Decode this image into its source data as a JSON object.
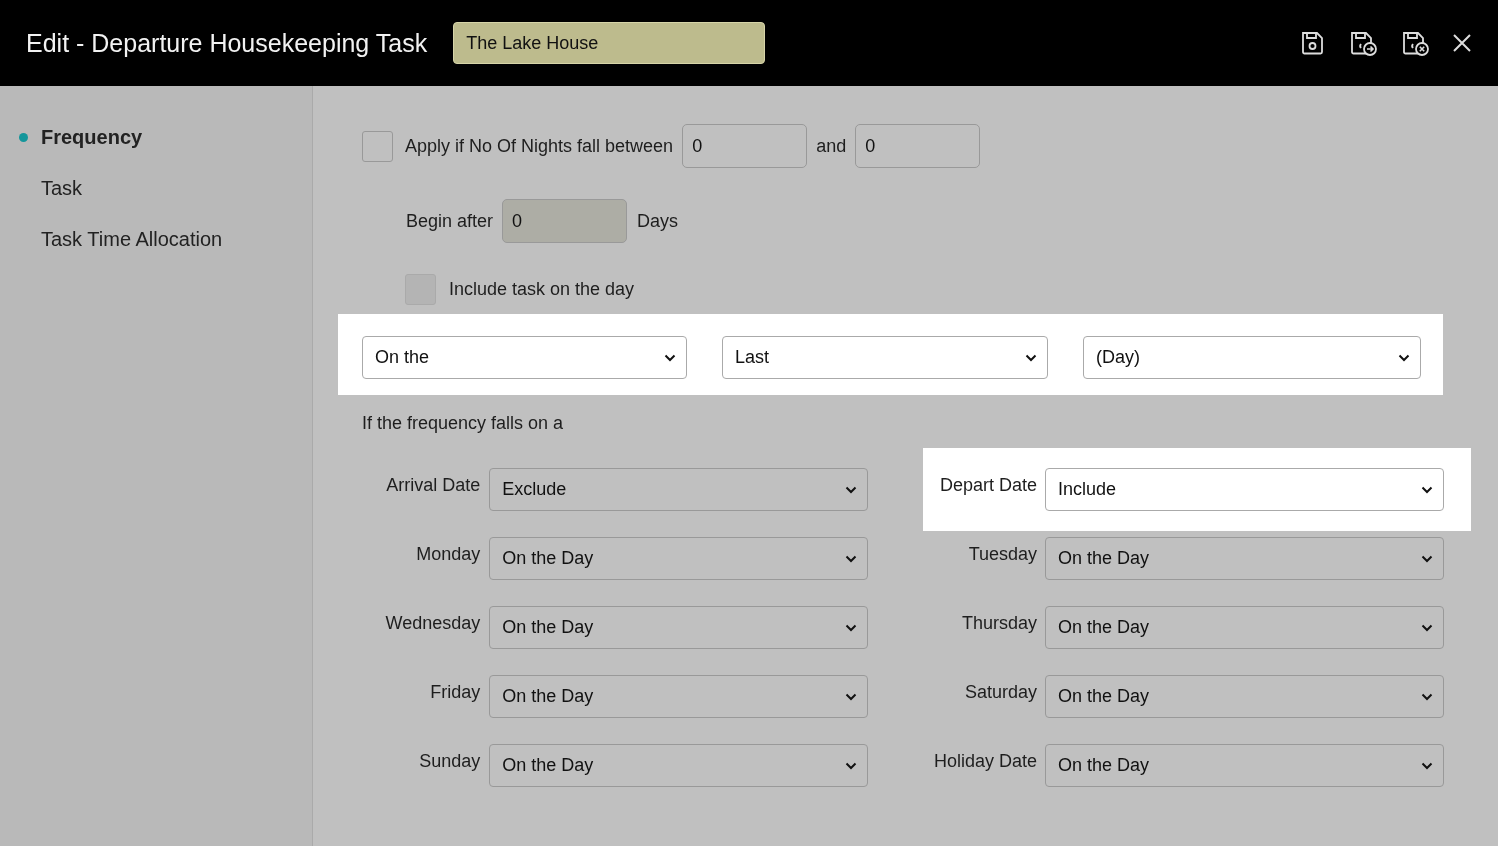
{
  "header": {
    "title": "Edit - Departure Housekeeping Task",
    "property": "The Lake House"
  },
  "sidebar": {
    "items": [
      {
        "label": "Frequency",
        "selected": true
      },
      {
        "label": "Task",
        "selected": false
      },
      {
        "label": "Task Time Allocation",
        "selected": false
      }
    ]
  },
  "nights": {
    "checked": false,
    "label": "Apply if No Of Nights fall between",
    "from": "0",
    "joiner": "and",
    "to": "0"
  },
  "begin_after": {
    "label": "Begin after",
    "value": "0",
    "disabled": true,
    "unit": "Days"
  },
  "include_on_day": {
    "label": "Include task on the day",
    "checked": false,
    "disabled": true
  },
  "frequency": {
    "highlighted": true,
    "selects": [
      {
        "value": "On the"
      },
      {
        "value": "Last"
      },
      {
        "value": "(Day)"
      }
    ]
  },
  "falls_on_label": "If the frequency falls on a",
  "rules": [
    {
      "label": "Arrival Date",
      "value": "Exclude",
      "highlighted": false
    },
    {
      "label": "Depart Date",
      "value": "Include",
      "highlighted": true
    },
    {
      "label": "Monday",
      "value": "On the Day",
      "highlighted": false
    },
    {
      "label": "Tuesday",
      "value": "On the Day",
      "highlighted": false
    },
    {
      "label": "Wednesday",
      "value": "On the Day",
      "highlighted": false
    },
    {
      "label": "Thursday",
      "value": "On the Day",
      "highlighted": false
    },
    {
      "label": "Friday",
      "value": "On the Day",
      "highlighted": false
    },
    {
      "label": "Saturday",
      "value": "On the Day",
      "highlighted": false
    },
    {
      "label": "Sunday",
      "value": "On the Day",
      "highlighted": false
    },
    {
      "label": "Holiday Date",
      "value": "On the Day",
      "highlighted": false
    }
  ]
}
